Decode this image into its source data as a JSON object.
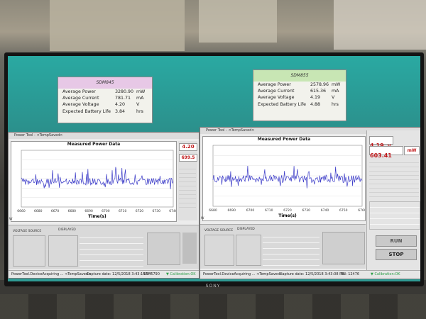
{
  "left_summary": {
    "title": "SDM845",
    "rows": [
      {
        "label": "Average Power",
        "value": "3280.90",
        "unit": "mW"
      },
      {
        "label": "Average Current",
        "value": "781.71",
        "unit": "mA"
      },
      {
        "label": "Average Voltage",
        "value": "4.20",
        "unit": "V"
      },
      {
        "label": "Expected Battery Life",
        "value": "3.84",
        "unit": "hrs"
      }
    ],
    "header_color": "#e7c8e6"
  },
  "right_summary": {
    "title": "SDM855",
    "rows": [
      {
        "label": "Average Power",
        "value": "2578.96",
        "unit": "mW"
      },
      {
        "label": "Average Current",
        "value": "615.36",
        "unit": "mA"
      },
      {
        "label": "Average Voltage",
        "value": "4.19",
        "unit": "V"
      },
      {
        "label": "Expected Battery Life",
        "value": "4.88",
        "unit": "hrs"
      }
    ],
    "header_color": "#c8e6b4"
  },
  "left_window": {
    "title": "Power Tool - <TempSaved>",
    "plot_title": "Measured Power Data",
    "xlabel": "Time(s)",
    "ylabel": "W",
    "xticks": [
      "6660",
      "6680",
      "6670",
      "6680",
      "6690",
      "6700",
      "6710",
      "6720",
      "6730",
      "6740"
    ],
    "voltage_value": "4.20",
    "power_value": "699.5",
    "voltage_source": "VOLTAGE SOURCE",
    "displayed": "DISPLAYED",
    "status_left": "PowerTool.DeviceAcquiring ... <TempSaved>",
    "capture_date": "Capture date: 12/5/2018 3:43:19 PM",
    "sn": "SN: 5790",
    "calibration": "Calibration:OK"
  },
  "right_window": {
    "title": "Power Tool - <TempSaved>",
    "plot_title": "Measured Power Data",
    "xlabel": "Time(s)",
    "ylabel": "W",
    "xticks": [
      "6680",
      "6690",
      "6700",
      "6710",
      "6720",
      "6730",
      "6740",
      "6750",
      "6760"
    ],
    "side_value_v": "4.19",
    "side_unit_v": "V",
    "side_value_ma": "603.41",
    "side_unit_ma": "mA",
    "side_unit_mw": "mW",
    "run_label": "RUN",
    "stop_label": "STOP",
    "voltage_source": "VOLTAGE SOURCE",
    "displayed": "DISPLAYED",
    "status_left": "PowerTool.DeviceAcquiring ... <TempSaved>",
    "capture_date": "Capture date: 12/5/2018 3:43:08 PM",
    "sn": "SN: 12476",
    "calibration": "Calibration:OK"
  },
  "brand": "SONY",
  "colors": {
    "screen": "#2f9b94",
    "trace": "#3c3cc8",
    "value_red": "#c0181a",
    "ok_green": "#2fa04a"
  }
}
